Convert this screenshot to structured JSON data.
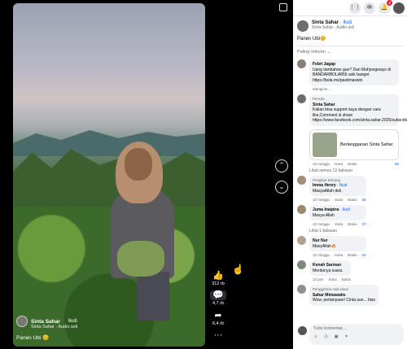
{
  "video": {
    "author_name": "Sinta Sahar",
    "follow_label": "Ikuti",
    "audio_label": "Sinta Sahar · Audio asli",
    "caption": "Panen Ubi 😊"
  },
  "actions": {
    "like_count": "312 rb",
    "comment_count": "4,7 rb",
    "share_count": "6,4 rb",
    "more_label": "···"
  },
  "topbar": {
    "notification_badge": "6"
  },
  "post": {
    "author_name": "Sinta Sahar",
    "follow_label": "Ikuti",
    "sub": "Sinta Sahar · Audio asli",
    "caption": "Panen Ubi😊"
  },
  "comments_sort": "Paling relevan ⌄",
  "comments": [
    {
      "name": "Febri Jagap",
      "text": "Uang tambahan gue? Dari Mahjongways di BANDARBOLA855 asik banget https://bola.ms/pastimaswin",
      "meta": [
        "Mengirim..."
      ]
    },
    {
      "pre": "Penulis",
      "name": "Sinta Sahar",
      "text": "Kalian bisa support saya dengan cara like,Comment & share https://www.facebook.com/sinta.sahar.2025/subscribenow...",
      "card_text": "Berlangganan Sinta Sahar",
      "meta": [
        "10 minggu",
        "Suka",
        "Balas"
      ],
      "react": "65"
    }
  ],
  "view_replies": "Lihat semua 13 balasan",
  "replies": [
    {
      "pre": "Pengikut Bintang",
      "name": "Imma Henry",
      "follow": "Ikuti",
      "text": "MasyaAllah dek",
      "meta": [
        "10 minggu",
        "Suka",
        "Balas"
      ],
      "react": "38"
    },
    {
      "name": "Juma Inaipira",
      "follow": "Ikuti",
      "text": "Masya Allah",
      "meta": [
        "10 minggu",
        "Suka",
        "Balas"
      ],
      "react": "37"
    }
  ],
  "view_reply": "Lihat 1 balasan",
  "more_comments": [
    {
      "name": "Nur Nur",
      "text": "MasyAllah🔥",
      "meta": [
        "10 minggu",
        "Suka",
        "Balas"
      ],
      "react": "24"
    },
    {
      "name": "Kenah Sarman",
      "text": "Merdunya suara.",
      "meta": [
        "10 jam",
        "Suka",
        "Balas"
      ]
    },
    {
      "pre": "Penggemar naik daun",
      "name": "Sahar Mimawatis",
      "text": "Wow, pertanyaan! Cinta sun... biso"
    }
  ],
  "composer": {
    "placeholder": "Tulis komentar...",
    "icons": "☺ ◎ ▣ ✦"
  }
}
